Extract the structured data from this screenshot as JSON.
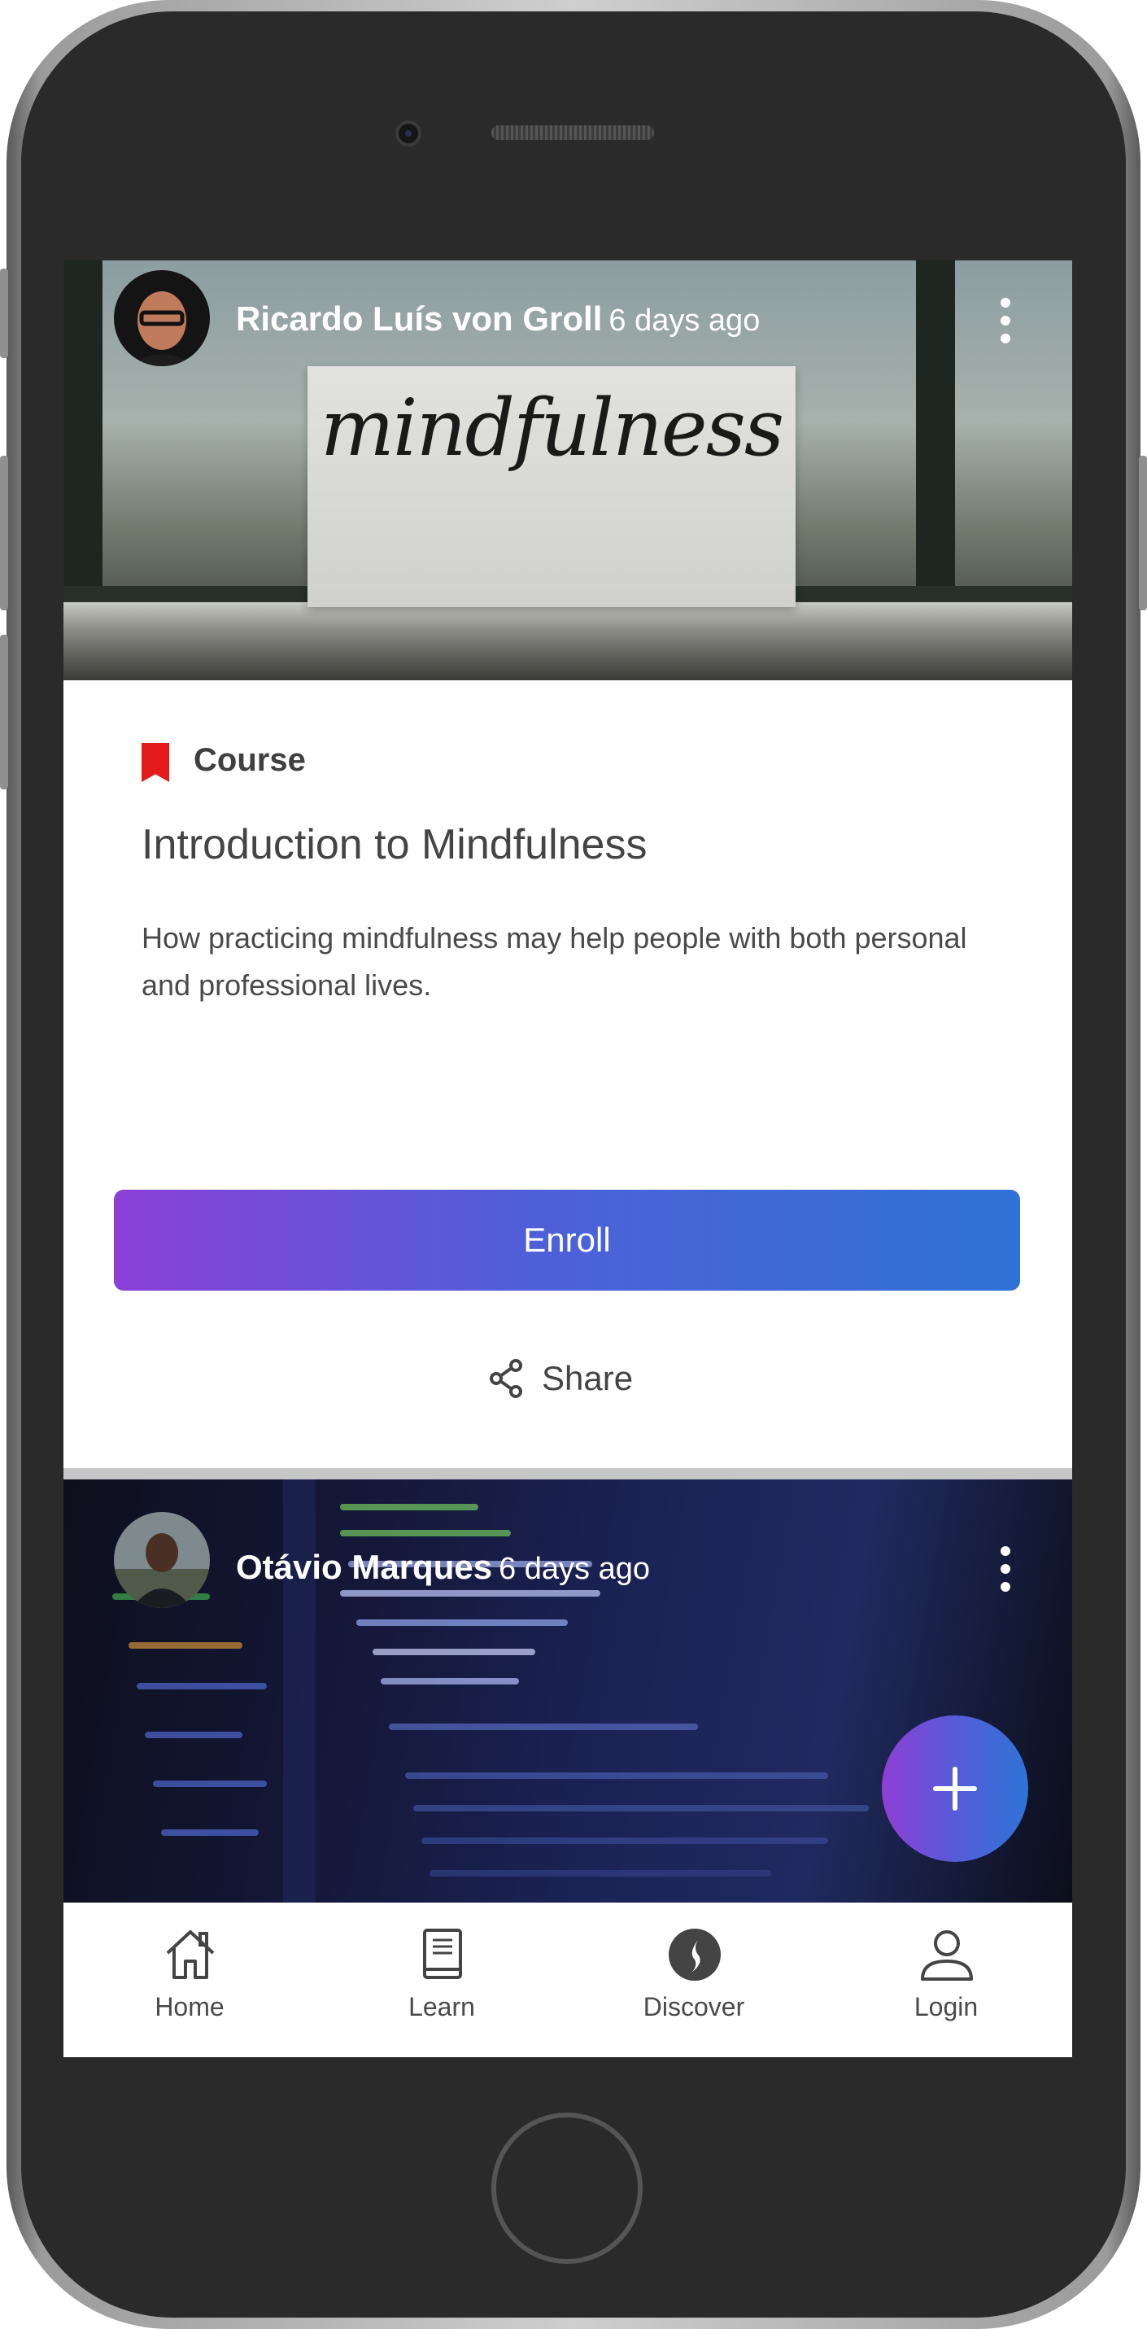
{
  "feed": {
    "posts": [
      {
        "author": "Ricardo Luís von Groll",
        "time": "6 days ago",
        "image_caption_text": "mindfulness",
        "type_label": "Course",
        "title": "Introduction to Mindfulness",
        "description": "How practicing mindfulness may help people with both personal and professional lives.",
        "enroll_label": "Enroll",
        "share_label": "Share"
      },
      {
        "author": "Otávio Marques",
        "time": "6 days ago"
      }
    ]
  },
  "fab": {
    "icon": "plus-icon"
  },
  "tabbar": {
    "items": [
      {
        "label": "Home",
        "icon": "home-icon"
      },
      {
        "label": "Learn",
        "icon": "book-icon"
      },
      {
        "label": "Discover",
        "icon": "compass-icon"
      },
      {
        "label": "Login",
        "icon": "user-icon"
      }
    ]
  },
  "colors": {
    "course_tag": "#e41b1b",
    "button_gradient_start": "#8a3fd6",
    "button_gradient_end": "#2f73d6"
  }
}
